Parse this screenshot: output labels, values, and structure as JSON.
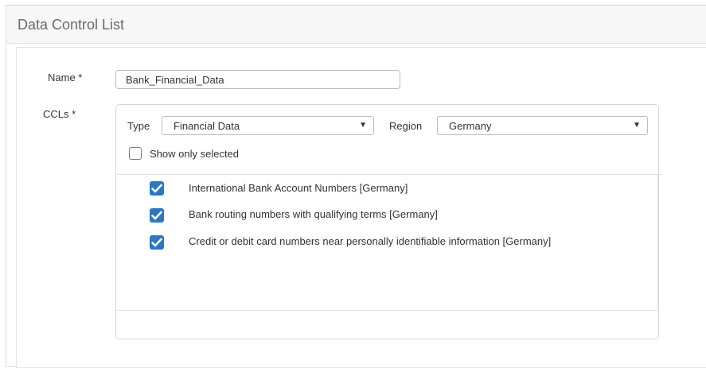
{
  "window": {
    "title": "Data Control List"
  },
  "form": {
    "name_label": "Name *",
    "name_value": "Bank_Financial_Data",
    "ccls_label": "CCLs *"
  },
  "filters": {
    "type_label": "Type",
    "type_value": "Financial Data",
    "region_label": "Region",
    "region_value": "Germany",
    "show_only_selected_label": "Show only selected",
    "show_only_selected_checked": false
  },
  "ccl_items": [
    {
      "label": "International Bank Account Numbers [Germany]",
      "checked": true
    },
    {
      "label": "Bank routing numbers with qualifying terms [Germany]",
      "checked": true
    },
    {
      "label": "Credit or debit card numbers near personally identifiable information [Germany]",
      "checked": true
    }
  ],
  "colors": {
    "checkbox_checked": "#2a78c5",
    "checkbox_border": "#5b7fb0"
  }
}
